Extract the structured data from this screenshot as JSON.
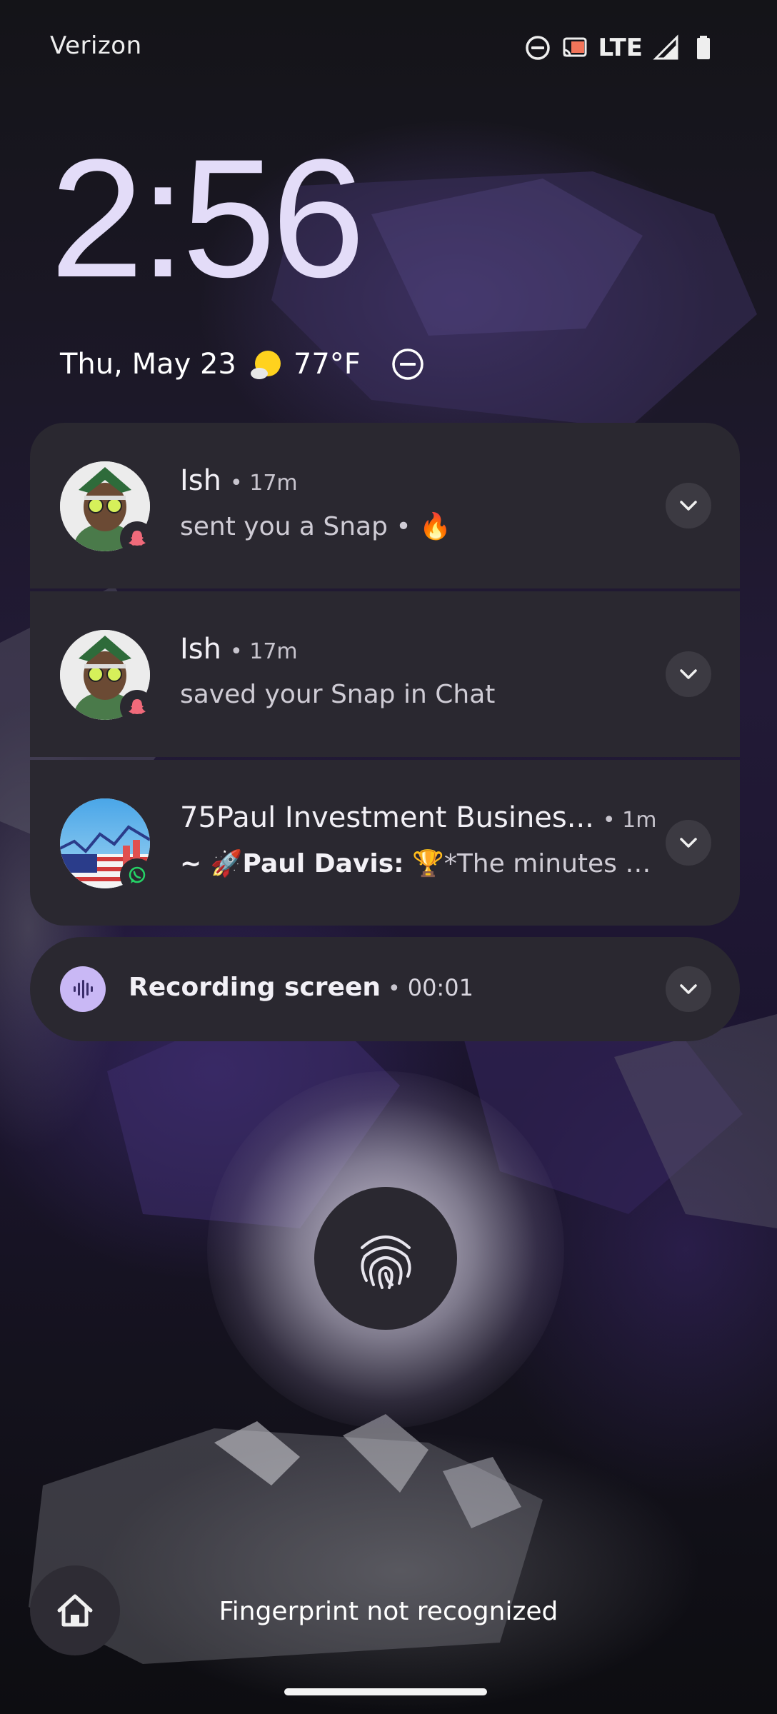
{
  "status_bar": {
    "carrier": "Verizon",
    "network": "LTE",
    "icons": [
      "dnd-icon",
      "cast-icon",
      "signal-icon",
      "battery-icon"
    ]
  },
  "lockscreen": {
    "time": "2:56",
    "date": "Thu, May 23",
    "weather_icon": "partly-sunny-icon",
    "temperature": "77°F",
    "status_icon": "dnd-icon"
  },
  "notifications": [
    {
      "sender": "Ish",
      "time": "• 17m",
      "message": "sent you a Snap • 🔥",
      "app_icon": "snapchat-icon",
      "avatar": "bitmoji-avatar"
    },
    {
      "sender": "Ish",
      "time": "• 17m",
      "message": "saved your Snap in Chat",
      "app_icon": "snapchat-icon",
      "avatar": "bitmoji-avatar"
    },
    {
      "sender": "75Paul Investment Busines...",
      "time": "• 1m",
      "message_prefix": "~ 🚀Paul Davis:",
      "message": " 🏆*The minutes of t...",
      "app_icon": "whatsapp-icon",
      "avatar": "group-avatar"
    }
  ],
  "recording": {
    "title": "Recording screen",
    "separator": "•",
    "elapsed": "00:01",
    "icon": "sound-wave-icon"
  },
  "fingerprint": {
    "icon": "fingerprint-icon",
    "message": "Fingerprint not recognized"
  },
  "bottom": {
    "home_icon": "home-icon"
  },
  "colors": {
    "card": "#2a2830",
    "clock": "#e3dcf8",
    "recording_accent": "#c9b8f5",
    "snapchat_badge": "#f06a7a",
    "whatsapp_badge": "#25d366"
  }
}
